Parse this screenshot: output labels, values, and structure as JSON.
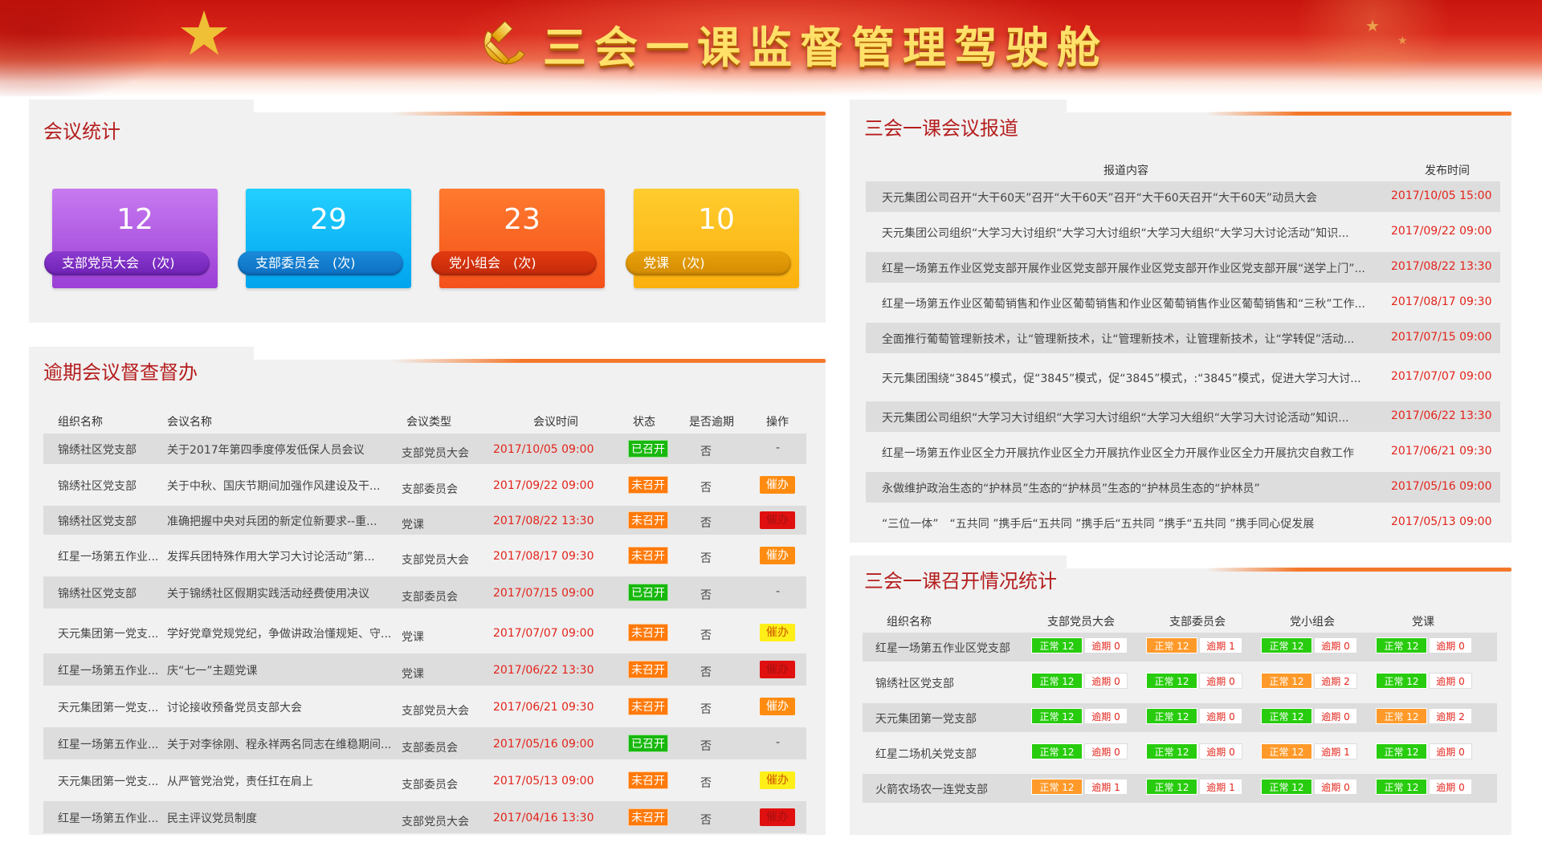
{
  "header": {
    "title": "三会一课监督管理驾驶舱"
  },
  "meeting_stats": {
    "title": "会议统计",
    "cards": [
      {
        "value": "12",
        "label": "支部党员大会　(次)",
        "color": "#9b3fd6"
      },
      {
        "value": "29",
        "label": "支部委员会　(次)",
        "color": "#00a4ee"
      },
      {
        "value": "23",
        "label": "党小组会　(次)",
        "color": "#f4511a"
      },
      {
        "value": "10",
        "label": "党课　(次)",
        "color": "#fbb00e"
      }
    ]
  },
  "overdue": {
    "title": "逾期会议督查督办",
    "headers": [
      "组织名称",
      "会议名称",
      "会议类型",
      "会议时间",
      "状态",
      "是否逾期",
      "操作"
    ],
    "rows": [
      {
        "org": "锦绣社区党支部",
        "name": "关于2017年第四季度停发低保人员会议",
        "type": "支部党员大会",
        "time": "2017/10/05  09:00",
        "status": "已召开",
        "status_kind": "open",
        "overdue": "否",
        "action": "-",
        "action_kind": "none"
      },
      {
        "org": "锦绣社区党支部",
        "name": "关于中秋、国庆节期间加强作风建设及干...",
        "type": "支部委员会",
        "time": "2017/09/22  09:00",
        "status": "未召开",
        "status_kind": "notopen",
        "overdue": "否",
        "action": "催办",
        "action_kind": "orange"
      },
      {
        "org": "锦绣社区党支部",
        "name": "准确把握中央对兵团的新定位新要求--重...",
        "type": "党课",
        "time": "2017/08/22  13:30",
        "status": "未召开",
        "status_kind": "notopen",
        "overdue": "否",
        "action": "催办",
        "action_kind": "red"
      },
      {
        "org": "红星一场第五作业...",
        "name": "发挥兵团特殊作用大学习大讨论活动”第...",
        "type": "支部党员大会",
        "time": "2017/08/17  09:30",
        "status": "未召开",
        "status_kind": "notopen",
        "overdue": "否",
        "action": "催办",
        "action_kind": "orange"
      },
      {
        "org": "锦绣社区党支部",
        "name": "关于锦绣社区假期实践活动经费使用决议",
        "type": "支部委员会",
        "time": "2017/07/15  09:00",
        "status": "已召开",
        "status_kind": "open",
        "overdue": "否",
        "action": "-",
        "action_kind": "none"
      },
      {
        "org": "天元集团第一党支...",
        "name": "学好党章党规党纪，争做讲政治懂规矩、守...",
        "type": "党课",
        "time": "2017/07/07  09:00",
        "status": "未召开",
        "status_kind": "notopen",
        "overdue": "否",
        "action": "催办",
        "action_kind": "yellow"
      },
      {
        "org": "红星一场第五作业...",
        "name": "庆“七一”主题党课",
        "type": "党课",
        "time": "2017/06/22  13:30",
        "status": "未召开",
        "status_kind": "notopen",
        "overdue": "否",
        "action": "催办",
        "action_kind": "red"
      },
      {
        "org": "天元集团第一党支...",
        "name": "讨论接收预备党员支部大会",
        "type": "支部党员大会",
        "time": "2017/06/21  09:30",
        "status": "未召开",
        "status_kind": "notopen",
        "overdue": "否",
        "action": "催办",
        "action_kind": "orange"
      },
      {
        "org": "红星一场第五作业...",
        "name": "关于对李徐刚、程永祥两名同志在维稳期间...",
        "type": "支部委员会",
        "time": "2017/05/16  09:00",
        "status": "已召开",
        "status_kind": "open",
        "overdue": "否",
        "action": "-",
        "action_kind": "none"
      },
      {
        "org": "天元集团第一党支...",
        "name": "从严管党治党，责任扛在肩上",
        "type": "支部委员会",
        "time": "2017/05/13  09:00",
        "status": "未召开",
        "status_kind": "notopen",
        "overdue": "否",
        "action": "催办",
        "action_kind": "yellow"
      },
      {
        "org": "红星一场第五作业...",
        "name": "民主评议党员制度",
        "type": "支部党员大会",
        "time": "2017/04/16  13:30",
        "status": "未召开",
        "status_kind": "notopen",
        "overdue": "否",
        "action": "催办",
        "action_kind": "red"
      }
    ]
  },
  "reports": {
    "title": "三会一课会议报道",
    "headers": [
      "报道内容",
      "发布时间"
    ],
    "rows": [
      {
        "content": "天元集团公司召开“大干60天”召开“大干60天”召开“大干60天召开“大干60天”动员大会",
        "time": "2017/10/05  15:00"
      },
      {
        "content": "天元集团公司组织“大学习大讨组织“大学习大讨组织“大学习大组织“大学习大讨论活动”知识...",
        "time": "2017/09/22  09:00"
      },
      {
        "content": "红星一场第五作业区党支部开展作业区党支部开展作业区党支部开作业区党支部开展“送学上门”...",
        "time": "2017/08/22  13:30"
      },
      {
        "content": "红星一场第五作业区葡萄销售和作业区葡萄销售和作业区葡萄销售作业区葡萄销售和“三秋”工作...",
        "time": "2017/08/17  09:30"
      },
      {
        "content": "全面推行葡萄管理新技术，让“管理新技术，让“管理新技术，让管理新技术，让“学转促”活动...",
        "time": "2017/07/15  09:00"
      },
      {
        "content": "天元集团围绕“3845”模式，促“3845”模式，促“3845”模式，:“3845”模式，促进大学习大讨...",
        "time": "2017/07/07  09:00"
      },
      {
        "content": "天元集团公司组织“大学习大讨组织“大学习大讨组织“大学习大组织“大学习大讨论活动”知识...",
        "time": "2017/06/22  13:30"
      },
      {
        "content": "红星一场第五作业区全力开展抗作业区全力开展抗作业区全力开展作业区全力开展抗灾自救工作",
        "time": "2017/06/21  09:30"
      },
      {
        "content": "永做维护政治生态的“护林员”生态的“护林员”生态的“护林员生态的“护林员”",
        "time": "2017/05/16  09:00"
      },
      {
        "content": "“三位一体”　“五共同 ”携手后“五共同 ”携手后“五共同 ”携手“五共同 ”携手同心促发展",
        "time": "2017/05/13  09:00"
      }
    ]
  },
  "summary": {
    "title": "三会一课召开情况统计",
    "headers": [
      "组织名称",
      "支部党员大会",
      "支部委员会",
      "党小组会",
      "党课"
    ],
    "rows": [
      {
        "org": "红星一场第五作业区党支部",
        "cells": [
          {
            "normal": "正常 12",
            "overdue": "逾期 0",
            "color": "green"
          },
          {
            "normal": "正常 12",
            "overdue": "逾期 1",
            "color": "orange"
          },
          {
            "normal": "正常 12",
            "overdue": "逾期 0",
            "color": "green"
          },
          {
            "normal": "正常 12",
            "overdue": "逾期 0",
            "color": "green"
          }
        ]
      },
      {
        "org": "锦绣社区党支部",
        "cells": [
          {
            "normal": "正常 12",
            "overdue": "逾期 0",
            "color": "green"
          },
          {
            "normal": "正常 12",
            "overdue": "逾期 0",
            "color": "green"
          },
          {
            "normal": "正常 12",
            "overdue": "逾期 2",
            "color": "orange"
          },
          {
            "normal": "正常 12",
            "overdue": "逾期 0",
            "color": "green"
          }
        ]
      },
      {
        "org": "天元集团第一党支部",
        "cells": [
          {
            "normal": "正常 12",
            "overdue": "逾期 0",
            "color": "green"
          },
          {
            "normal": "正常 12",
            "overdue": "逾期 0",
            "color": "green"
          },
          {
            "normal": "正常 12",
            "overdue": "逾期 0",
            "color": "green"
          },
          {
            "normal": "正常 12",
            "overdue": "逾期 2",
            "color": "orange"
          }
        ]
      },
      {
        "org": "红星二场机关党支部",
        "cells": [
          {
            "normal": "正常 12",
            "overdue": "逾期 0",
            "color": "green"
          },
          {
            "normal": "正常 12",
            "overdue": "逾期 0",
            "color": "green"
          },
          {
            "normal": "正常 12",
            "overdue": "逾期 1",
            "color": "orange"
          },
          {
            "normal": "正常 12",
            "overdue": "逾期 0",
            "color": "green"
          }
        ]
      },
      {
        "org": "火箭农场农一连党支部",
        "cells": [
          {
            "normal": "正常 12",
            "overdue": "逾期 1",
            "color": "orange"
          },
          {
            "normal": "正常 12",
            "overdue": "逾期 1",
            "color": "green"
          },
          {
            "normal": "正常 12",
            "overdue": "逾期 0",
            "color": "green"
          },
          {
            "normal": "正常 12",
            "overdue": "逾期 0",
            "color": "green"
          }
        ]
      }
    ]
  }
}
